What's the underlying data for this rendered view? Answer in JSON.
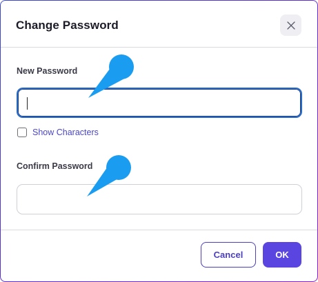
{
  "dialog": {
    "title": "Change Password",
    "close_icon": "close-icon"
  },
  "new_password": {
    "label": "New Password",
    "value": "",
    "placeholder": ""
  },
  "show_characters": {
    "label": "Show Characters",
    "checked": false
  },
  "confirm_password": {
    "label": "Confirm Password",
    "value": "",
    "placeholder": ""
  },
  "footer": {
    "cancel_label": "Cancel",
    "ok_label": "OK"
  },
  "colors": {
    "accent": "#5b45e0",
    "link": "#4a46c8",
    "focus_border": "#2a6cc4",
    "annotation_marker": "#1a9cf0"
  }
}
